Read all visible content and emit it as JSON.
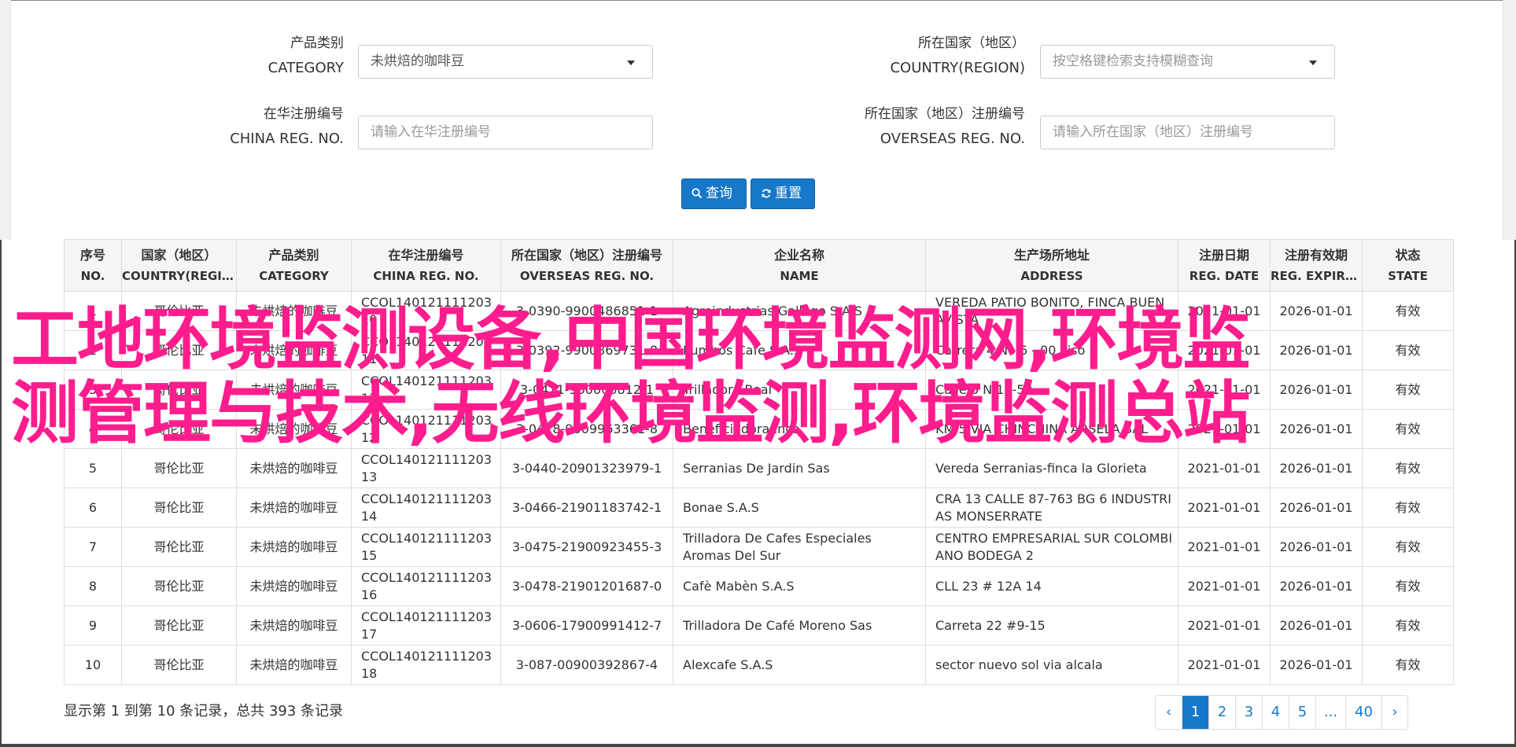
{
  "filters": {
    "category": {
      "label_zh": "产品类别",
      "label_en": "CATEGORY",
      "value": "未烘焙的咖啡豆"
    },
    "country": {
      "label_zh": "所在国家（地区）",
      "label_en": "COUNTRY(REGION)",
      "placeholder": "按空格键检索支持模糊查询"
    },
    "china_reg": {
      "label_zh": "在华注册编号",
      "label_en": "CHINA REG. NO.",
      "placeholder": "请输入在华注册编号"
    },
    "overseas_reg": {
      "label_zh": "所在国家（地区）注册编号",
      "label_en": "OVERSEAS REG. NO.",
      "placeholder": "请输入所在国家（地区）注册编号"
    },
    "search_label": "查询",
    "reset_label": "重置"
  },
  "table": {
    "headers": [
      {
        "zh": "序号",
        "en": "NO."
      },
      {
        "zh": "国家（地区）",
        "en": "COUNTRY(REGIO…"
      },
      {
        "zh": "产品类别",
        "en": "CATEGORY"
      },
      {
        "zh": "在华注册编号",
        "en": "CHINA REG. NO."
      },
      {
        "zh": "所在国家（地区）注册编号",
        "en": "OVERSEAS REG. NO."
      },
      {
        "zh": "企业名称",
        "en": "NAME"
      },
      {
        "zh": "生产场所地址",
        "en": "ADDRESS"
      },
      {
        "zh": "注册日期",
        "en": "REG. DATE"
      },
      {
        "zh": "注册有效期",
        "en": "REG. EXPIRE …"
      },
      {
        "zh": "状态",
        "en": "STATE"
      }
    ],
    "rows": [
      [
        "1",
        "哥伦比亚",
        "未烘焙的咖啡豆",
        "CCOL14012111120310",
        "3-0390-9900486851-1",
        "Agroindustrias Gallego S.A.S",
        "VEREDA PATIO BONITO, FINCA BUENAVISTA",
        "2021-01-01",
        "2026-01-01",
        "有效"
      ],
      [
        "2",
        "哥伦比亚",
        "未烘焙的咖啡豆",
        "CCOL14012111120311",
        "3-0392-9900869731-8",
        "Pumbos Cafe S.A.S",
        "Carrera 4 No 6 - 00 Piso 5",
        "2021-01-01",
        "2026-01-01",
        "有效"
      ],
      [
        "3",
        "哥伦比亚",
        "未烘焙的咖啡豆",
        "CCOL14012111120312",
        "3-0411-900000812-1",
        "Trilladora Real",
        "Calle 6 N 17-52",
        "2021-01-01",
        "2026-01-01",
        "有效"
      ],
      [
        "4",
        "哥伦比亚",
        "未烘焙的咖啡豆",
        "CCOL14012111120312",
        "3-0428-9009963361-8",
        "Beneficiadora Inca",
        "KM 5 VIA CHINCHINA ARSELA SAL",
        "2021-01-01",
        "2026-01-01",
        "有效"
      ],
      [
        "5",
        "哥伦比亚",
        "未烘焙的咖啡豆",
        "CCOL14012111120313",
        "3-0440-20901323979-1",
        "Serranias De Jardin Sas",
        "Vereda Serranias-finca la Glorieta",
        "2021-01-01",
        "2026-01-01",
        "有效"
      ],
      [
        "6",
        "哥伦比亚",
        "未烘焙的咖啡豆",
        "CCOL14012111120314",
        "3-0466-21901183742-1",
        "Bonae S.A.S",
        "CRA 13 CALLE 87-763 BG 6 INDUSTRIAS MONSERRATE",
        "2021-01-01",
        "2026-01-01",
        "有效"
      ],
      [
        "7",
        "哥伦比亚",
        "未烘焙的咖啡豆",
        "CCOL14012111120315",
        "3-0475-21900923455-3",
        "Trilladora De Cafes Especiales Aromas Del Sur",
        "CENTRO EMPRESARIAL SUR COLOMBIANO BODEGA 2",
        "2021-01-01",
        "2026-01-01",
        "有效"
      ],
      [
        "8",
        "哥伦比亚",
        "未烘焙的咖啡豆",
        "CCOL14012111120316",
        "3-0478-21901201687-0",
        "Cafè Mabèn S.A.S",
        "CLL 23 # 12A 14",
        "2021-01-01",
        "2026-01-01",
        "有效"
      ],
      [
        "9",
        "哥伦比亚",
        "未烘焙的咖啡豆",
        "CCOL14012111120317",
        "3-0606-17900991412-7",
        "Trilladora De Café Moreno Sas",
        "Carreta 22 #9-15",
        "2021-01-01",
        "2026-01-01",
        "有效"
      ],
      [
        "10",
        "哥伦比亚",
        "未烘焙的咖啡豆",
        "CCOL14012111120318",
        "3-087-00900392867-4",
        "Alexcafe S.A.S",
        "sector nuevo sol via alcala",
        "2021-01-01",
        "2026-01-01",
        "有效"
      ]
    ]
  },
  "overlay_text": {
    "line1": "工地环境监测设备,中国环境监测网,环境监",
    "line2": "测管理与技术,无线环境监测,环境监测总站"
  },
  "footer": {
    "summary": "显示第 1 到第 10 条记录，总共 393 条记录",
    "pages": [
      "‹",
      "1",
      "2",
      "3",
      "4",
      "5",
      "...",
      "40",
      "›"
    ],
    "active_page": "1"
  },
  "colors": {
    "primary": "#1778c9",
    "overlay": "#ff1d8d",
    "border": "#dddddd"
  }
}
